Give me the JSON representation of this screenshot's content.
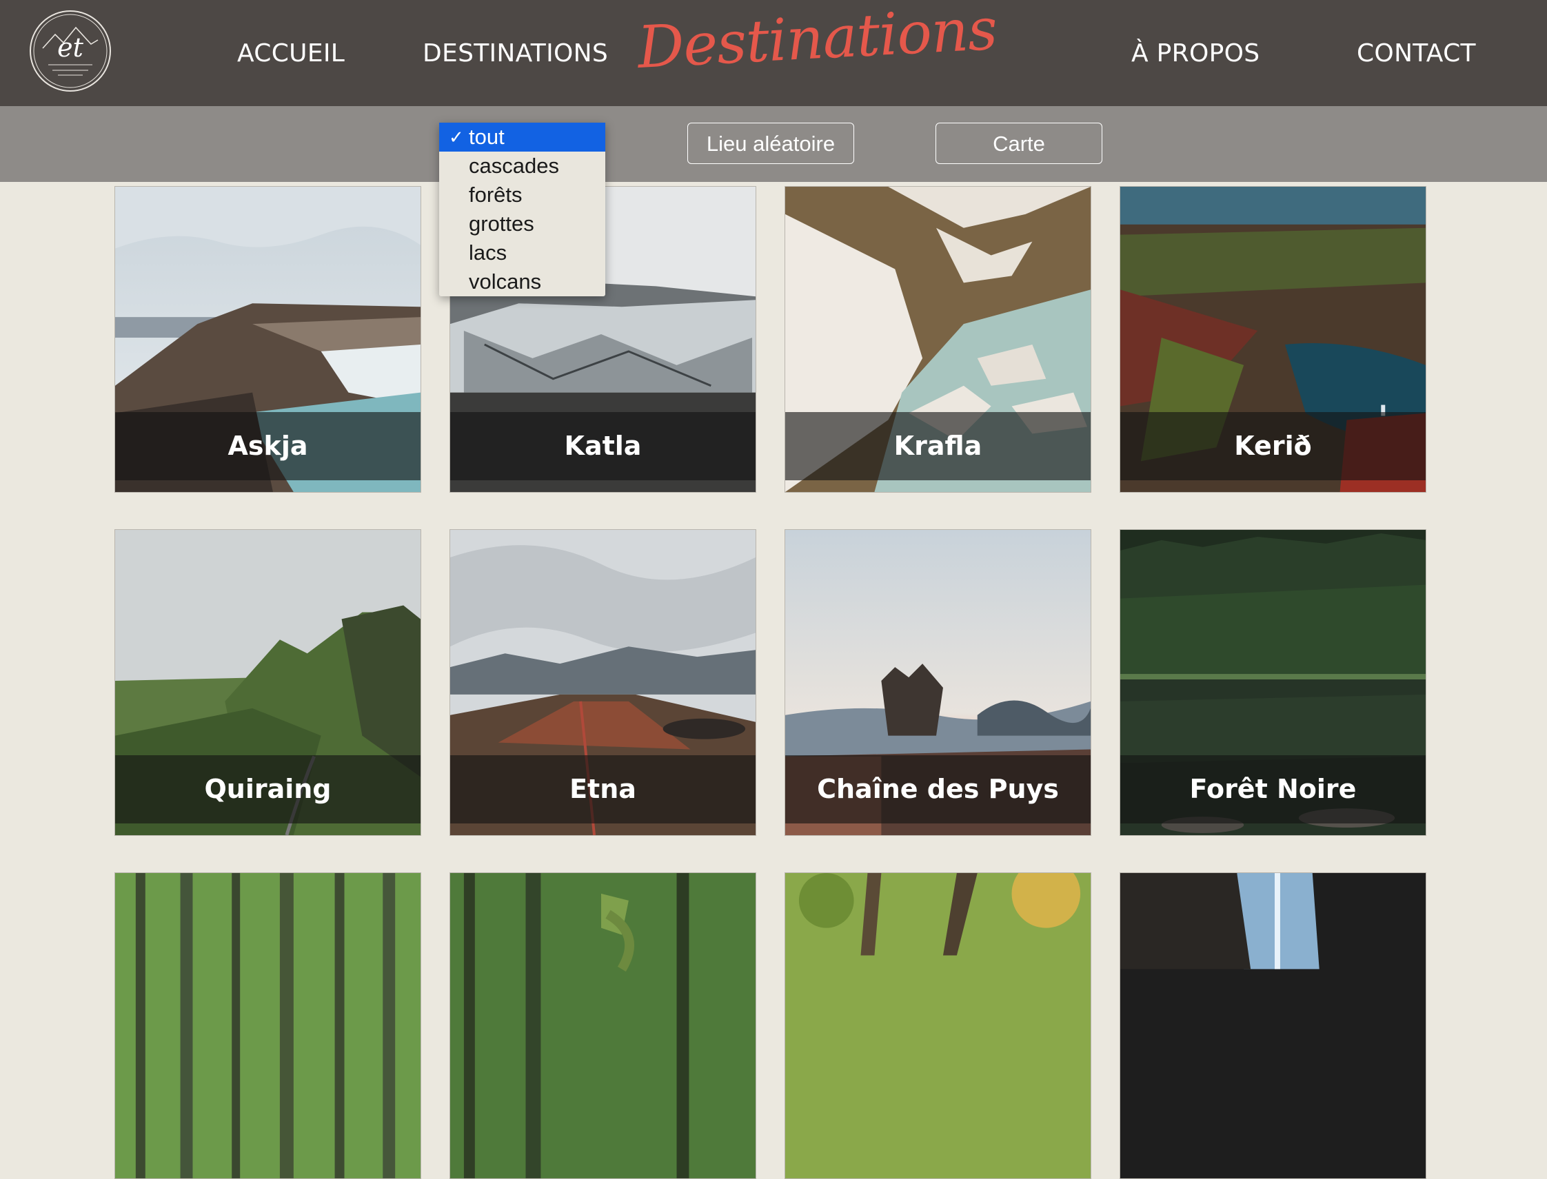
{
  "header": {
    "logo_text": "et",
    "nav": {
      "accueil": "ACCUEIL",
      "destinations": "DESTINATIONS",
      "apropos": "À PROPOS",
      "contact": "CONTACT"
    },
    "brand_title": "Destinations"
  },
  "toolbar": {
    "filter": {
      "selected": "tout",
      "options": [
        "tout",
        "cascades",
        "forêts",
        "grottes",
        "lacs",
        "volcans"
      ]
    },
    "random_button": "Lieu aléatoire",
    "map_button": "Carte"
  },
  "cards": [
    {
      "name": "Askja"
    },
    {
      "name": "Katla"
    },
    {
      "name": "Krafla"
    },
    {
      "name": "Kerið"
    },
    {
      "name": "Quiraing"
    },
    {
      "name": "Etna"
    },
    {
      "name": "Chaîne des Puys"
    },
    {
      "name": "Forêt Noire"
    }
  ],
  "colors": {
    "header_bg": "#4d4845",
    "brand": "#e5584b",
    "toolbar_bg": "#8e8b88",
    "page_bg": "#ebe8df",
    "selected_option": "#1262e3"
  }
}
